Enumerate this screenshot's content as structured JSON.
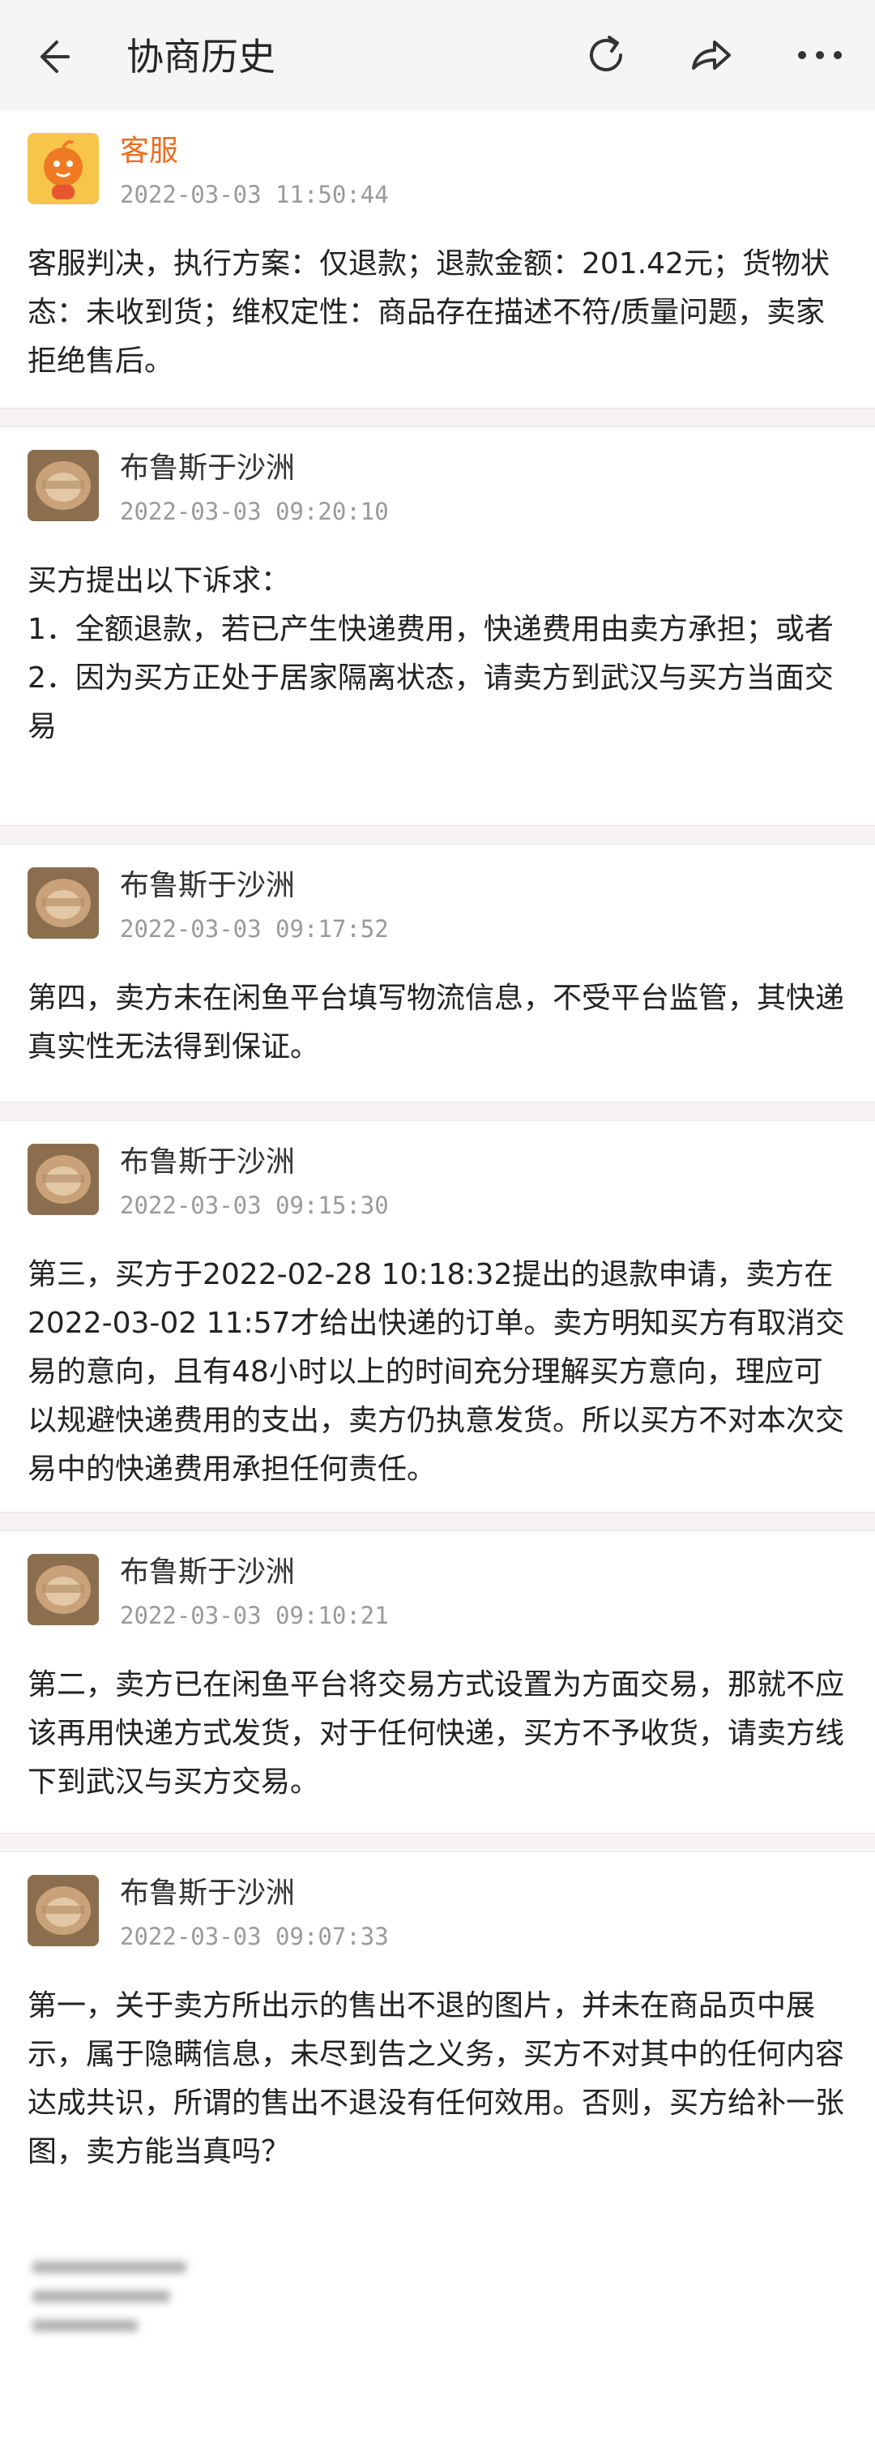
{
  "header": {
    "title": "协商历史"
  },
  "messages": [
    {
      "sender": "客服",
      "time": "2022-03-03 11:50:44",
      "text": "客服判决，执行方案：仅退款；退款金额：201.42元；货物状态：未收到货；维权定性：商品存在描述不符/质量问题，卖家拒绝售后。"
    },
    {
      "sender": "布鲁斯于沙洲",
      "time": "2022-03-03 09:20:10",
      "text": "买方提出以下诉求：\n1．全额退款，若已产生快递费用，快递费用由卖方承担；或者\n2．因为买方正处于居家隔离状态，请卖方到武汉与买方当面交易"
    },
    {
      "sender": "布鲁斯于沙洲",
      "time": "2022-03-03 09:17:52",
      "text": "第四，卖方未在闲鱼平台填写物流信息，不受平台监管，其快递真实性无法得到保证。"
    },
    {
      "sender": "布鲁斯于沙洲",
      "time": "2022-03-03 09:15:30",
      "text": "第三，买方于2022-02-28 10:18:32提出的退款申请，卖方在2022-03-02 11:57才给出快递的订单。卖方明知买方有取消交易的意向，且有48小时以上的时间充分理解买方意向，理应可以规避快递费用的支出，卖方仍执意发货。所以买方不对本次交易中的快递费用承担任何责任。"
    },
    {
      "sender": "布鲁斯于沙洲",
      "time": "2022-03-03 09:10:21",
      "text": "第二，卖方已在闲鱼平台将交易方式设置为方面交易，那就不应该再用快递方式发货，对于任何快递，买方不予收货，请卖方线下到武汉与买方交易。"
    },
    {
      "sender": "布鲁斯于沙洲",
      "time": "2022-03-03 09:07:33",
      "text": "第一，关于卖方所出示的售出不退的图片，并未在商品页中展示，属于隐瞒信息，未尽到告之义务，买方不对其中的任何内容达成共识，所谓的售出不退没有任何效用。否则，买方给补一张图，卖方能当真吗？"
    }
  ],
  "colors": {
    "header_bg": "#f3f6f2",
    "service_name": "#ee6c1f",
    "separator": "#f7f2f4",
    "time_text": "#9a9a9a"
  }
}
